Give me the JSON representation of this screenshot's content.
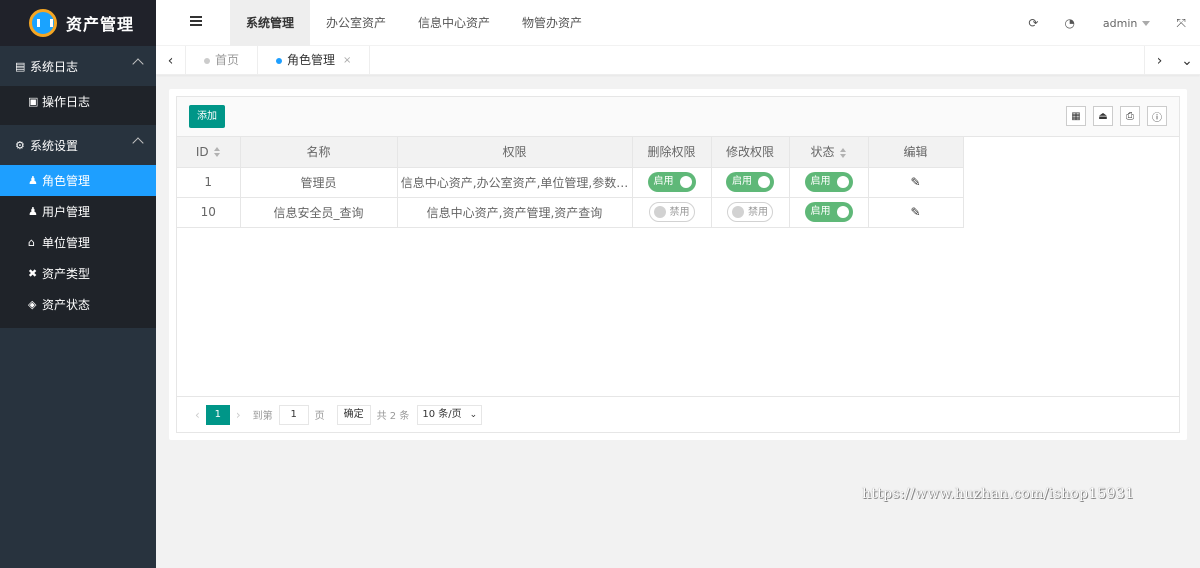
{
  "app": {
    "title": "资产管理"
  },
  "sidebar": {
    "groups": [
      {
        "label": "系统日志",
        "icon": "file-icon",
        "items": [
          {
            "label": "操作日志",
            "icon": "doc-icon"
          }
        ]
      },
      {
        "label": "系统设置",
        "icon": "gears-icon",
        "items": [
          {
            "label": "角色管理",
            "icon": "user-icon"
          },
          {
            "label": "用户管理",
            "icon": "user-icon"
          },
          {
            "label": "单位管理",
            "icon": "bank-icon"
          },
          {
            "label": "资产类型",
            "icon": "tools-icon"
          },
          {
            "label": "资产状态",
            "icon": "cube-icon"
          }
        ]
      }
    ],
    "active_item": "角色管理"
  },
  "header": {
    "nav": [
      "系统管理",
      "办公室资产",
      "信息中心资产",
      "物管办资产"
    ],
    "active_nav": "系统管理",
    "user": "admin"
  },
  "tabs": [
    {
      "label": "首页"
    },
    {
      "label": "角色管理",
      "close": "×"
    }
  ],
  "toolbar": {
    "add_label": "添加"
  },
  "table": {
    "columns": [
      "ID",
      "名称",
      "权限",
      "删除权限",
      "修改权限",
      "状态",
      "编辑"
    ],
    "rows": [
      {
        "id": "1",
        "name": "管理员",
        "perms": "信息中心资产,办公室资产,单位管理,参数…",
        "del": "启用",
        "mod": "启用",
        "status": "启用"
      },
      {
        "id": "10",
        "name": "信息安全员_查询",
        "perms": "信息中心资产,资产管理,资产查询",
        "del": "禁用",
        "mod": "禁用",
        "status": "启用"
      }
    ]
  },
  "pager": {
    "current": "1",
    "goto_label": "到第",
    "goto_value": "1",
    "page_label": "页",
    "confirm": "确定",
    "total": "共 2 条",
    "page_size": "10 条/页"
  },
  "watermark": "https://www.huzhan.com/ishop15931",
  "colors": {
    "accent": "#1e9fff",
    "primary": "#009688",
    "switch_on": "#5fb878",
    "sidebar_bg": "#28333e"
  }
}
